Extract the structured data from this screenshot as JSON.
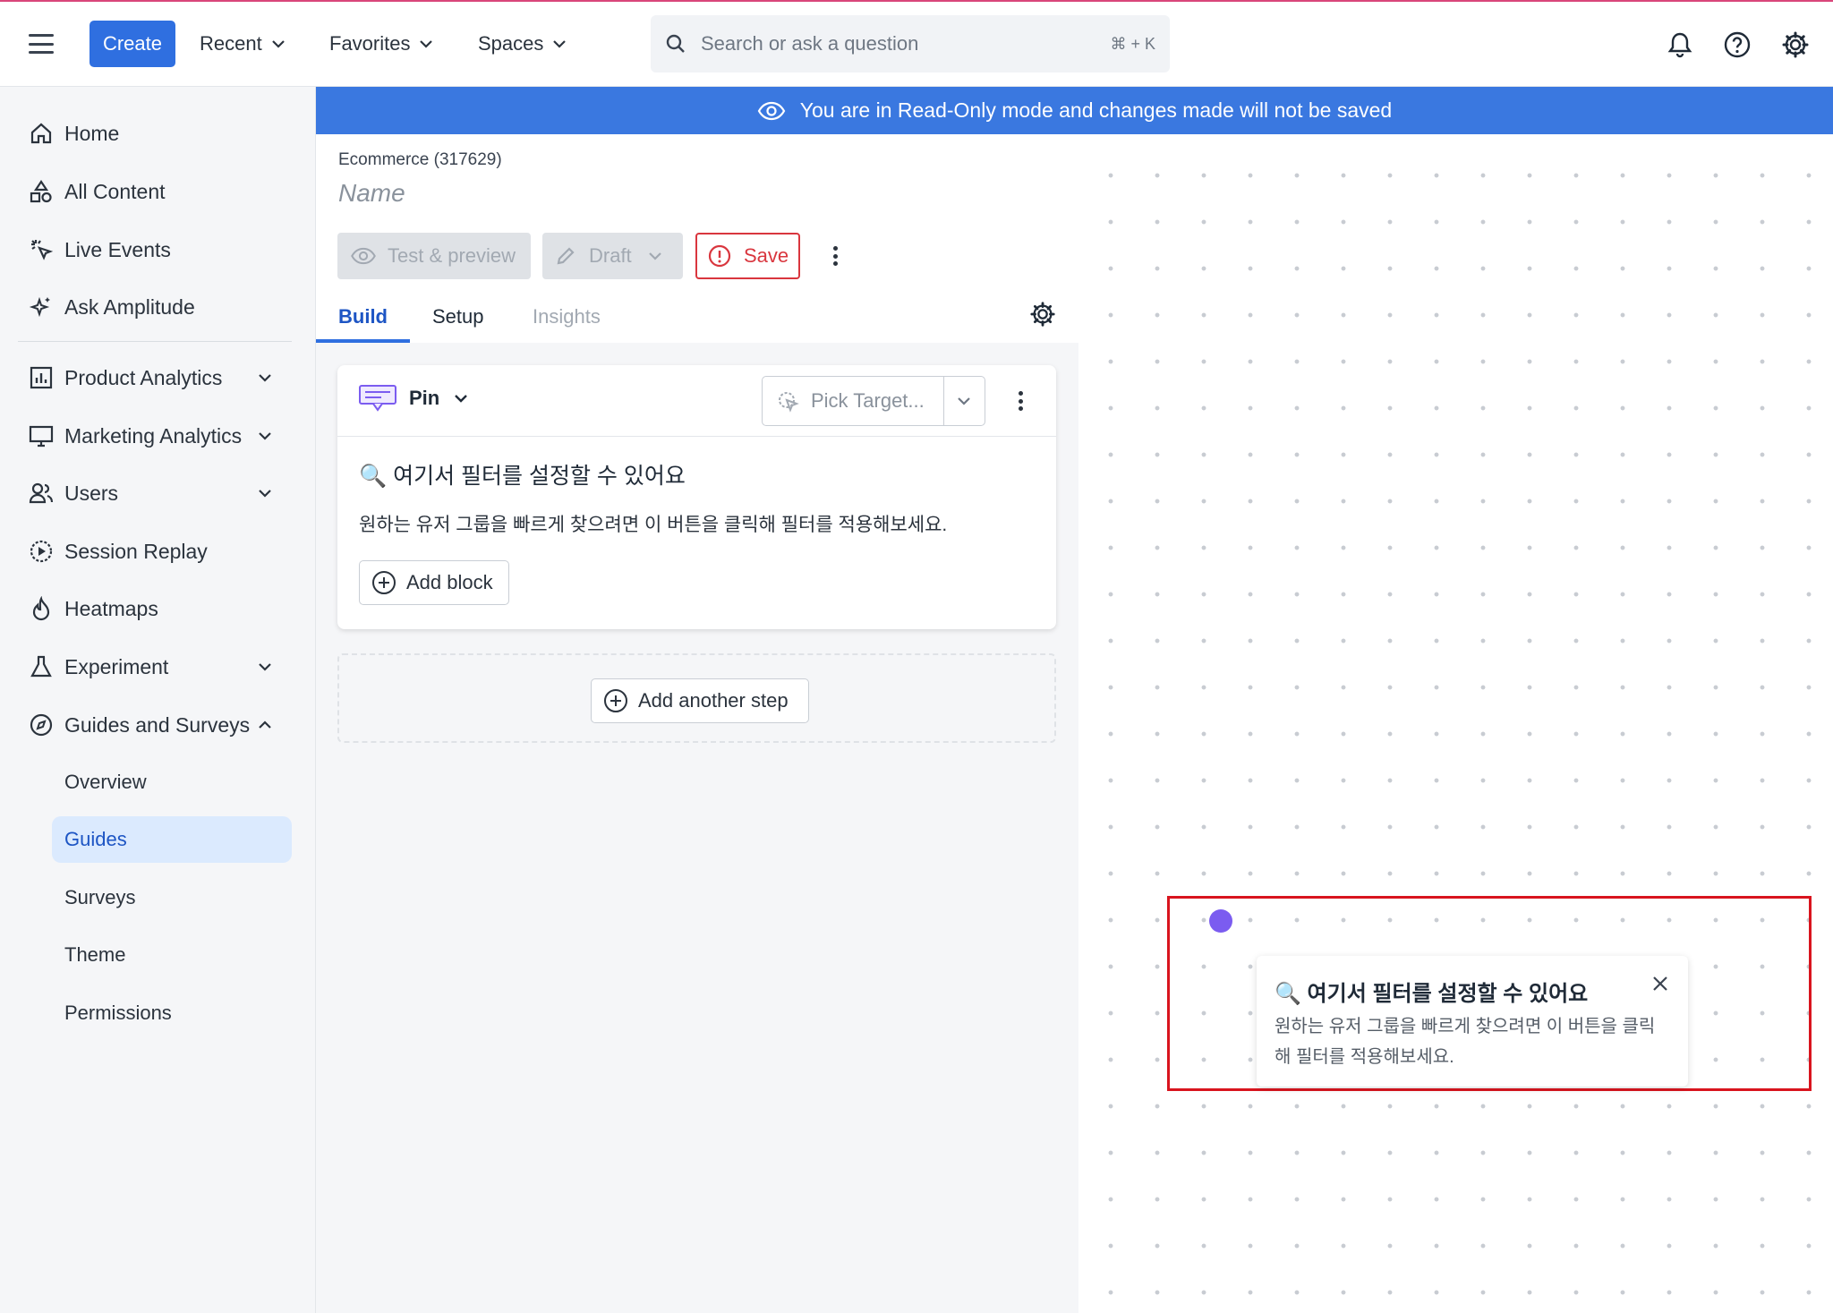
{
  "topbar": {
    "create_label": "Create",
    "nav": [
      "Recent",
      "Favorites",
      "Spaces"
    ],
    "search_placeholder": "Search or ask a question",
    "search_shortcut": "⌘ + K",
    "icons": [
      "bell-icon",
      "help-icon",
      "gear-icon"
    ]
  },
  "sidebar": {
    "items": [
      {
        "label": "Home",
        "icon": "home-icon"
      },
      {
        "label": "All Content",
        "icon": "shapes-icon"
      },
      {
        "label": "Live Events",
        "icon": "cursor-click-icon"
      },
      {
        "label": "Ask Amplitude",
        "icon": "sparkle-icon"
      },
      {
        "label": "Product Analytics",
        "icon": "bar-chart-icon"
      },
      {
        "label": "Marketing Analytics",
        "icon": "monitor-icon"
      },
      {
        "label": "Users",
        "icon": "users-icon"
      },
      {
        "label": "Session Replay",
        "icon": "play-circle-icon"
      },
      {
        "label": "Heatmaps",
        "icon": "flame-icon"
      },
      {
        "label": "Experiment",
        "icon": "flask-icon"
      },
      {
        "label": "Guides and Surveys",
        "icon": "compass-icon"
      }
    ],
    "sub_items": [
      "Overview",
      "Guides",
      "Surveys",
      "Theme",
      "Permissions"
    ],
    "active_sub_item": "Guides"
  },
  "banner": {
    "text": "You are in Read-Only mode and changes made will not be saved"
  },
  "editor": {
    "project": "Ecommerce (317629)",
    "name_placeholder": "Name",
    "buttons": {
      "test_preview": "Test & preview",
      "draft": "Draft",
      "save": "Save"
    },
    "tabs": [
      "Build",
      "Setup",
      "Insights"
    ],
    "active_tab": "Build",
    "step": {
      "type": "Pin",
      "target_placeholder": "Pick Target...",
      "title": "🔍 여기서 필터를 설정할 수 있어요",
      "body": "원하는 유저 그룹을 빠르게 찾으려면 이 버튼을 클릭해 필터를 적용해보세요.",
      "add_block": "Add block"
    },
    "add_step": "Add another step"
  },
  "preview": {
    "title": "🔍 여기서 필터를 설정할 수 있어요",
    "body": "원하는 유저 그룹을 빠르게 찾으려면 이 버튼을 클릭해 필터를 적용해보세요.",
    "beacon_color": "#7b5cf0",
    "highlight_color": "#d9141e"
  },
  "colors": {
    "accent": "#2f6fe0",
    "banner": "#3a78e0",
    "save": "#d9363e",
    "active_nav_bg": "#dbeafe"
  }
}
